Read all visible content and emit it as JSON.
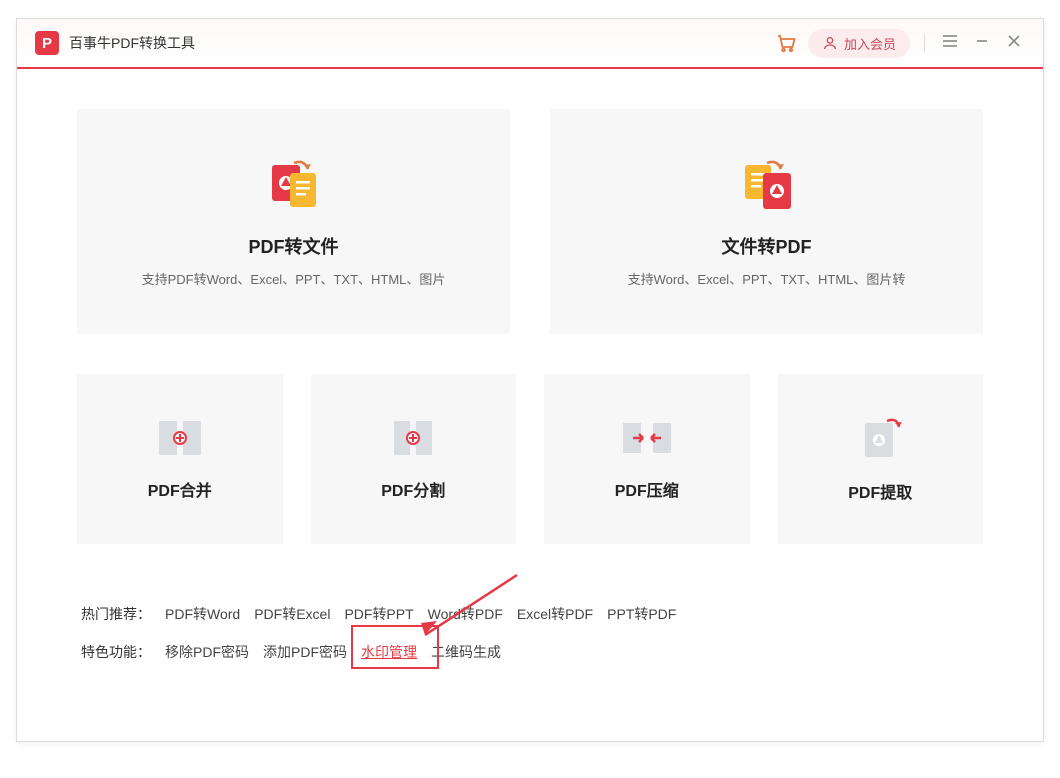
{
  "titlebar": {
    "app_name": "百事牛PDF转换工具",
    "member_label": "加入会员"
  },
  "main_cards": {
    "pdf_to_file": {
      "title": "PDF转文件",
      "desc": "支持PDF转Word、Excel、PPT、TXT、HTML、图片"
    },
    "file_to_pdf": {
      "title": "文件转PDF",
      "desc": "支持Word、Excel、PPT、TXT、HTML、图片转"
    }
  },
  "small_cards": {
    "merge": "PDF合并",
    "split": "PDF分割",
    "compress": "PDF压缩",
    "extract": "PDF提取"
  },
  "bottom": {
    "hot_label": "热门推荐：",
    "hot_items": [
      "PDF转Word",
      "PDF转Excel",
      "PDF转PPT",
      "Word转PDF",
      "Excel转PDF",
      "PPT转PDF"
    ],
    "feature_label": "特色功能：",
    "feature_items": [
      "移除PDF密码",
      "添加PDF密码",
      "水印管理",
      "二维码生成"
    ]
  }
}
